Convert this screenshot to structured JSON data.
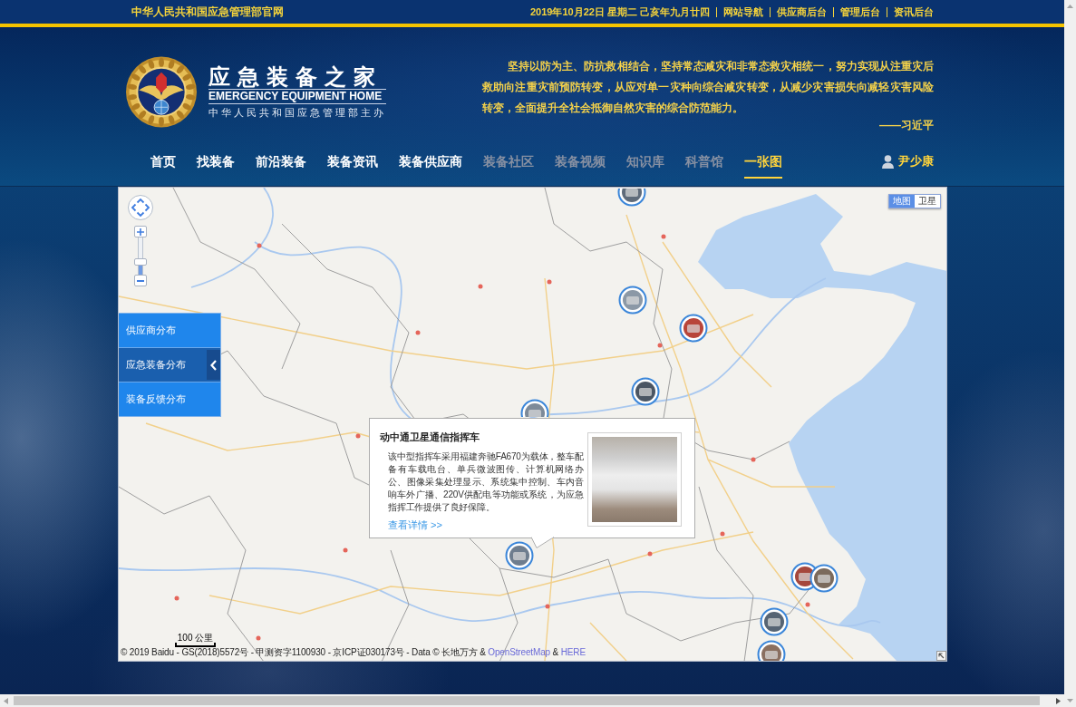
{
  "top_bar": {
    "site_name": "中华人民共和国应急管理部官网",
    "date": "2019年10月22日 星期二 己亥年九月廿四",
    "links": [
      "网站导航",
      "供应商后台",
      "管理后台",
      "资讯后台"
    ]
  },
  "header": {
    "brand": {
      "title": "应急装备之家",
      "subtitle": "EMERGENCY EQUIPMENT HOME",
      "sponsor": "中华人民共和国应急管理部主办"
    },
    "quote": {
      "lines": [
        "坚持以防为主、防抗救相结合，坚持常态减灾和非常态救灾相统一，努力实现从注重灾后",
        "救助向注重灾前预防转变，从应对单一灾种向综合减灾转变，从减少灾害损失向减轻灾害风险",
        "转变，全面提升全社会抵御自然灾害的综合防范能力。"
      ],
      "author": "——习近平"
    }
  },
  "nav": {
    "items": [
      {
        "label": "首页",
        "disabled": false,
        "selected": false
      },
      {
        "label": "找装备",
        "disabled": false,
        "selected": false
      },
      {
        "label": "前沿装备",
        "disabled": false,
        "selected": false
      },
      {
        "label": "装备资讯",
        "disabled": false,
        "selected": false
      },
      {
        "label": "装备供应商",
        "disabled": false,
        "selected": false
      },
      {
        "label": "装备社区",
        "disabled": true,
        "selected": false
      },
      {
        "label": "装备视频",
        "disabled": true,
        "selected": false
      },
      {
        "label": "知识库",
        "disabled": true,
        "selected": false
      },
      {
        "label": "科普馆",
        "disabled": true,
        "selected": false
      },
      {
        "label": "一张图",
        "disabled": false,
        "selected": true
      }
    ],
    "user": "尹少康"
  },
  "map": {
    "zoom": {
      "level": 0.3
    },
    "map_types": [
      {
        "label": "地图",
        "selected": true
      },
      {
        "label": "卫星",
        "selected": false
      }
    ],
    "layers": [
      {
        "label": "供应商分布",
        "selected": false
      },
      {
        "label": "应急装备分布",
        "selected": true
      },
      {
        "label": "装备反馈分布",
        "selected": false
      }
    ],
    "info_window": {
      "title": "动中通卫星通信指挥车",
      "description_lines": [
        "该中型指挥车采用福建奔驰FA670为载体，整车配",
        "备有车载电台、单兵微波图传、计算机网络办",
        "公、图像采集处理显示、系统集中控制、车内音",
        "响车外广播、220V供配电等功能或系统，为应急",
        "指挥工作提供了良好保障。"
      ],
      "link": "查看详情 >>"
    },
    "scale": "100 公里",
    "attribution": [
      {
        "kind": "text",
        "text": "© 2019 Baidu - GS(2018)5572号 - 甲测资字1100930 - 京ICP证030173号 - Data © 长地万方 &"
      },
      {
        "kind": "link",
        "text": "OpenStreetMap"
      },
      {
        "kind": "text",
        "text": "&"
      },
      {
        "kind": "link",
        "text": "HERE"
      }
    ]
  }
}
